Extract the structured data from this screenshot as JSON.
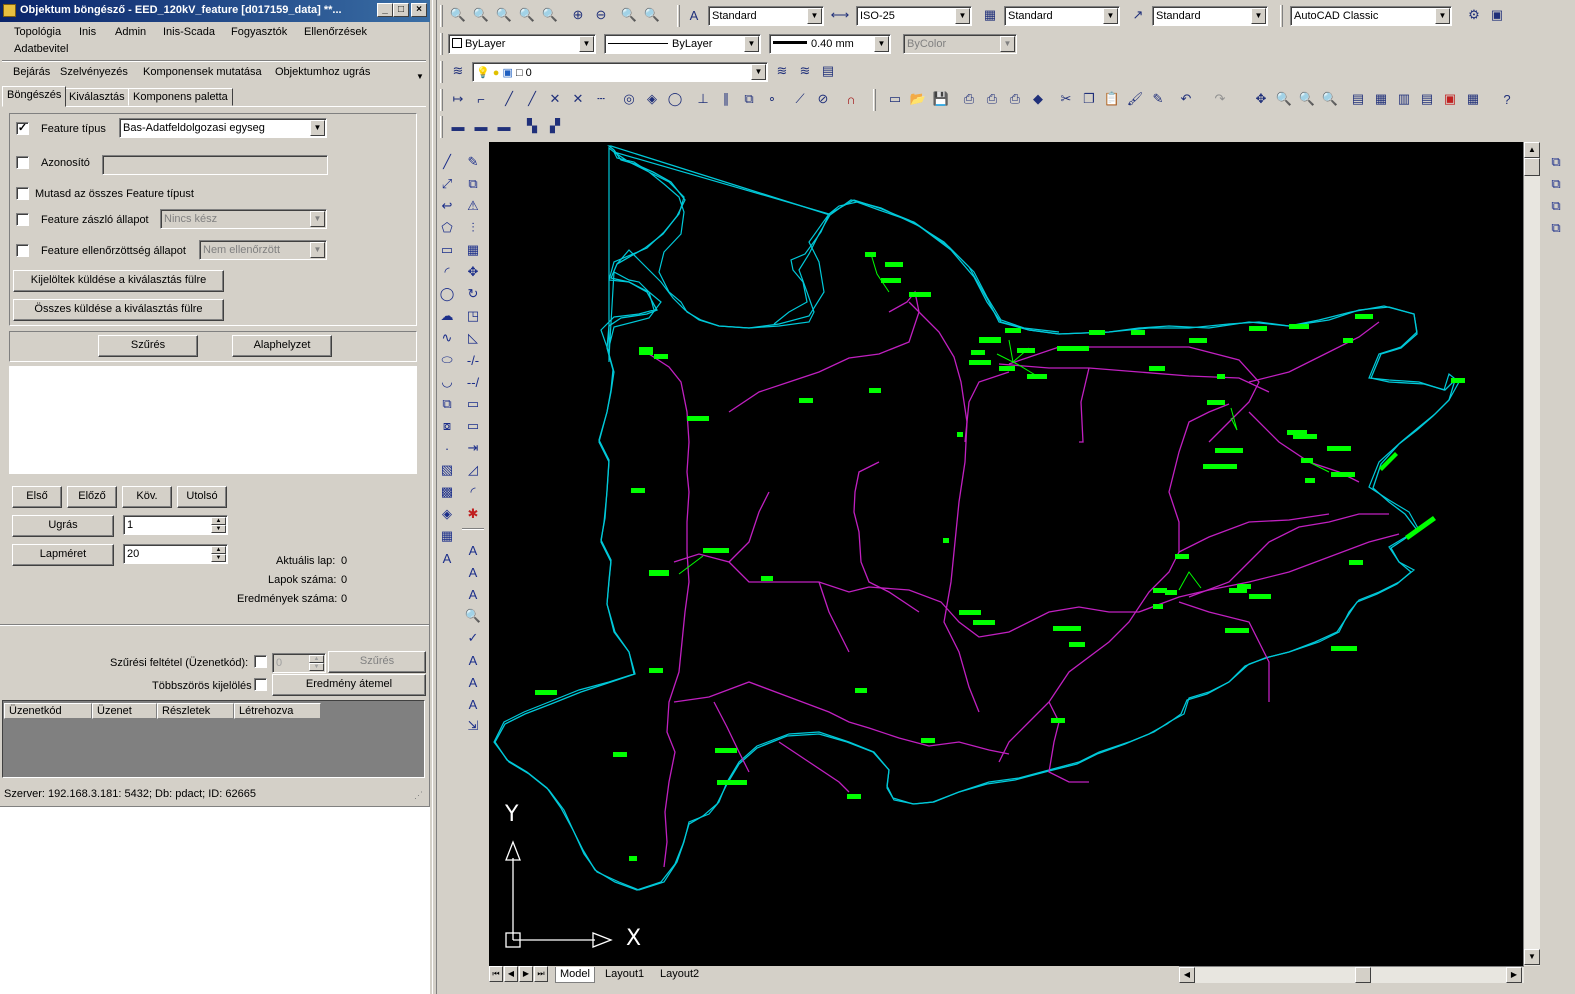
{
  "window": {
    "title": "Objektum böngésző - EED_120kV_feature [d017159_data] **..."
  },
  "menu": {
    "items": [
      "Topológia",
      "Inis",
      "Admin",
      "Inis-Scada",
      "Fogyasztók",
      "Ellenőrzések",
      "Adatbevitel"
    ]
  },
  "toolbar": {
    "items": [
      "Bejárás",
      "Szelvényezés",
      "Komponensek mutatása",
      "Objektumhoz ugrás"
    ]
  },
  "tabs": [
    "Böngészés",
    "Kiválasztás",
    "Komponens paletta"
  ],
  "filters": {
    "feature_type": {
      "label": "Feature típus",
      "value": "Bas-Adatfeldolgozasi egyseg",
      "checked": true
    },
    "identifier": {
      "label": "Azonosító",
      "value": ""
    },
    "show_all": {
      "label": "Mutasd az összes Feature típust"
    },
    "flag_state": {
      "label": "Feature zászló állapot",
      "value": "Nincs kész"
    },
    "checked_state": {
      "label": "Feature ellenőrzöttség állapot",
      "value": "Nem ellenőrzött"
    },
    "send_selected": "Kijelöltek küldése a kiválasztás fülre",
    "send_all": "Összes küldése a kiválasztás fülre"
  },
  "filter_buttons": {
    "filter": "Szűrés",
    "reset": "Alaphelyzet"
  },
  "pager": {
    "first": "Első",
    "prev": "Előző",
    "next": "Köv.",
    "last": "Utolsó",
    "jump_label": "Ugrás",
    "jump_value": "1",
    "page_size_label": "Lapméret",
    "page_size_value": "20",
    "current_page_label": "Aktuális lap:",
    "current_page": "0",
    "page_count_label": "Lapok száma:",
    "page_count": "0",
    "result_count_label": "Eredmények száma:",
    "result_count": "0"
  },
  "message_filter": {
    "label": "Szűrési feltétel (Üzenetkód):",
    "value": "0",
    "button": "Szűrés",
    "multi_label": "Többszörös kijelölés",
    "transfer_button": "Eredmény átemel"
  },
  "message_grid": {
    "columns": [
      "Üzenetkód",
      "Üzenet",
      "Részletek",
      "Létrehozva"
    ]
  },
  "status": "Szerver: 192.168.3.181: 5432; Db: pdact; ID: 62665",
  "cad": {
    "text_style": "Standard",
    "dim_style": "ISO-25",
    "table_style": "Standard",
    "multileader_style": "Standard",
    "workspace": "AutoCAD Classic",
    "layer_color": "ByLayer",
    "linetype": "ByLayer",
    "lineweight": "0.40 mm",
    "plot_style": "ByColor",
    "current_layer": "0",
    "layout_tabs": [
      "Model",
      "Layout1",
      "Layout2"
    ],
    "ucs_labels": {
      "x": "X",
      "y": "Y"
    },
    "colors": {
      "background": "#000000",
      "boundary": "#00c8d8",
      "lines": "#c020c0",
      "features": "#00ff00"
    }
  }
}
